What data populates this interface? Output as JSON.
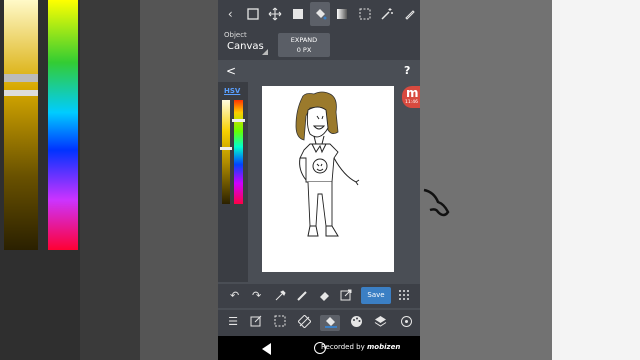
{
  "object_bar": {
    "label": "Object",
    "value": "Canvas",
    "expand_label": "EXPAND",
    "expand_value": "0 PX"
  },
  "nav": {
    "back_symbol": "<",
    "help_symbol": "?"
  },
  "color_panel": {
    "mode_label": "HSV",
    "value_level": 0.45,
    "hue_level": 0.18
  },
  "recording_badge": {
    "letter": "m",
    "time": "11:46"
  },
  "toolbar_bottom": {
    "save_label": "Save"
  },
  "system_bar": {
    "recorded_by": "Recorded by",
    "brand": "mobizen"
  },
  "colors": {
    "accent": "#3b7fc4",
    "app_bg": "#4a4e55",
    "toolbar_bg": "#3d4047",
    "badge": "#d84a3f"
  },
  "icons": {
    "top": [
      "back-icon",
      "select-rect-icon",
      "move-icon",
      "fill-rect-icon",
      "bucket-icon",
      "gradient-icon",
      "marquee-icon",
      "magic-wand-icon",
      "pen-icon"
    ],
    "bottom1": [
      "undo-icon",
      "redo-icon",
      "eyedropper-icon",
      "pen-icon",
      "eraser-icon",
      "export-icon",
      "grid-icon"
    ],
    "bottom2": [
      "menu-icon",
      "edit-icon",
      "selection-icon",
      "rotate-icon",
      "bucket-icon",
      "palette-icon",
      "layers-icon",
      "circle-icon"
    ]
  }
}
